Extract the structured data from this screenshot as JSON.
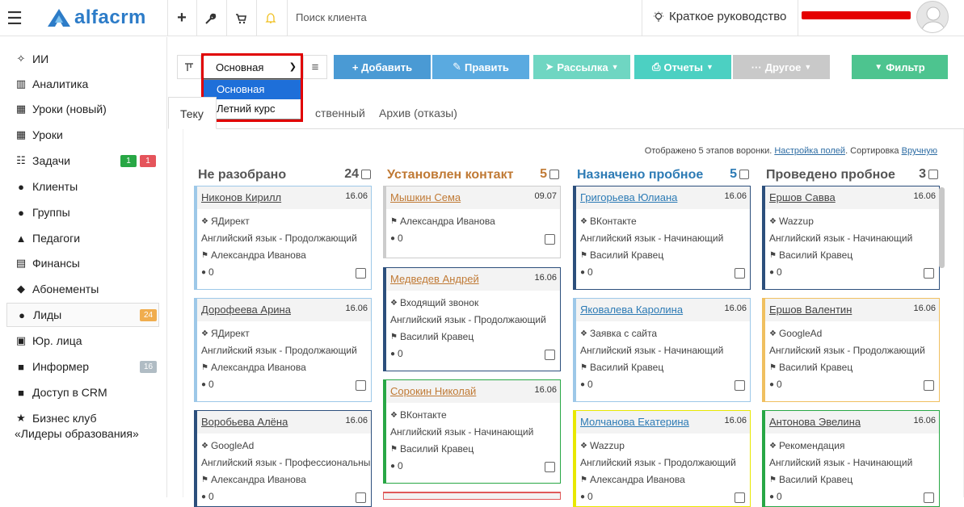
{
  "header": {
    "logo_text": "alfacrm",
    "search_placeholder": "Поиск клиента",
    "guide_label": "Краткое руководство",
    "icons": [
      "menu-icon",
      "plus-icon",
      "wrench-icon",
      "cart-icon",
      "bell-icon",
      "lightbulb-icon"
    ]
  },
  "sidebar": {
    "items": [
      {
        "label": "ИИ",
        "icon": "sparkle-icon"
      },
      {
        "label": "Аналитика",
        "icon": "columns-icon"
      },
      {
        "label": "Уроки (новый)",
        "icon": "calendar-icon"
      },
      {
        "label": "Уроки",
        "icon": "calendar-icon"
      },
      {
        "label": "Задачи",
        "icon": "task-icon",
        "badges": [
          {
            "text": "1",
            "color": "#28a745"
          },
          {
            "text": "1",
            "color": "#e5545b"
          }
        ]
      },
      {
        "label": "Клиенты",
        "icon": "user-icon"
      },
      {
        "label": "Группы",
        "icon": "users-icon"
      },
      {
        "label": "Педагоги",
        "icon": "graduation-icon"
      },
      {
        "label": "Финансы",
        "icon": "money-icon"
      },
      {
        "label": "Абонементы",
        "icon": "tag-icon"
      },
      {
        "label": "Лиды",
        "icon": "person-icon",
        "badges": [
          {
            "text": "24",
            "color": "#f0ad4e"
          }
        ]
      },
      {
        "label": "Юр. лица",
        "icon": "building-icon"
      },
      {
        "label": "Информер",
        "icon": "folder-icon",
        "badges": [
          {
            "text": "16",
            "color": "#b0bcc4"
          }
        ]
      },
      {
        "label": "Доступ в CRM",
        "icon": "lock-icon"
      },
      {
        "label": "Бизнес клуб",
        "icon": "star-icon"
      }
    ],
    "club_subtitle": "«Лидеры образования»"
  },
  "toolbar": {
    "funnel_selected": "Основная",
    "funnel_options": [
      "Основная",
      "Летний курс"
    ],
    "buttons": {
      "add": "+ Добавить",
      "edit": "Править",
      "mailing": "Рассылка",
      "reports": "Отчеты",
      "other": "Другое",
      "filter": "Фильтр"
    },
    "colors": {
      "add": "#4a9ad4",
      "edit": "#5aaae0",
      "mailing": "#6fd6c2",
      "reports": "#4cd0c2",
      "other": "#c9c9c9",
      "filter": "#4dc48f"
    }
  },
  "tabs": [
    "Теку",
    "ственный",
    "Архив (отказы)"
  ],
  "info": {
    "shown": "Отображено 5 этапов воронки.",
    "settings_link": "Настройка полей",
    "sort_label": ". Сортировка",
    "sort_link": "Вручную"
  },
  "columns": [
    {
      "title": "Не разобрано",
      "count": "24",
      "color": "#555555",
      "cards": [
        {
          "name": "Никонов Кирилл",
          "date": "16.06",
          "source": "ЯДирект",
          "course": "Английский язык - Продолжающий",
          "teacher": "Александра Иванова",
          "comments": "0",
          "border": "#9dc8e8"
        },
        {
          "name": "Дорофеева Арина",
          "date": "16.06",
          "source": "ЯДирект",
          "course": "Английский язык - Продолжающий",
          "teacher": "Александра Иванова",
          "comments": "0",
          "border": "#9dc8e8"
        },
        {
          "name": "Воробьева Алёна",
          "date": "16.06",
          "source": "GoogleAd",
          "course": "Английский язык - Профессиональный",
          "teacher": "Александра Иванова",
          "comments": "0",
          "border": "#2c4f7c"
        }
      ]
    },
    {
      "title": "Установлен контакт",
      "count": "5",
      "color": "#c07a35",
      "cards": [
        {
          "name": "Мышкин Сема",
          "date": "09.07",
          "source": "",
          "course": "",
          "teacher": "Александра Иванова",
          "comments": "0",
          "border": "#cccccc"
        },
        {
          "name": "Медведев Андрей",
          "date": "16.06",
          "source": "Входящий звонок",
          "course": "Английский язык - Продолжающий",
          "teacher": "Василий Кравец",
          "comments": "0",
          "border": "#2c4f7c"
        },
        {
          "name": "Сорокин Николай",
          "date": "16.06",
          "source": "ВКонтакте",
          "course": "Английский язык - Начинающий",
          "teacher": "Василий Кравец",
          "comments": "0",
          "border": "#28a745"
        }
      ]
    },
    {
      "title": "Назначено пробное",
      "count": "5",
      "color": "#2d7bb5",
      "cards": [
        {
          "name": "Григорьева Юлиана",
          "date": "16.06",
          "source": "ВКонтакте",
          "course": "Английский язык - Начинающий",
          "teacher": "Василий Кравец",
          "comments": "0",
          "border": "#2c4f7c"
        },
        {
          "name": "Яковалева Каролина",
          "date": "16.06",
          "source": "Заявка с сайта",
          "course": "Английский язык - Начинающий",
          "teacher": "Василий Кравец",
          "comments": "0",
          "border": "#9dc8e8"
        },
        {
          "name": "Молчанова Екатерина",
          "date": "16.06",
          "source": "Wazzup",
          "course": "Английский язык - Продолжающий",
          "teacher": "Александра Иванова",
          "comments": "0",
          "border": "#e8e800"
        }
      ]
    },
    {
      "title": "Проведено пробное",
      "count": "3",
      "color": "#555555",
      "cards": [
        {
          "name": "Ершов Савва",
          "date": "16.06",
          "source": "Wazzup",
          "course": "Английский язык - Начинающий",
          "teacher": "Василий Кравец",
          "comments": "0",
          "border": "#2c4f7c"
        },
        {
          "name": "Ершов Валентин",
          "date": "16.06",
          "source": "GoogleAd",
          "course": "Английский язык - Продолжающий",
          "teacher": "Василий Кравец",
          "comments": "0",
          "border": "#f0c060"
        },
        {
          "name": "Антонова Эвелина",
          "date": "16.06",
          "source": "Рекомендация",
          "course": "Английский язык - Начинающий",
          "teacher": "Василий Кравец",
          "comments": "0",
          "border": "#28a745"
        }
      ]
    }
  ]
}
